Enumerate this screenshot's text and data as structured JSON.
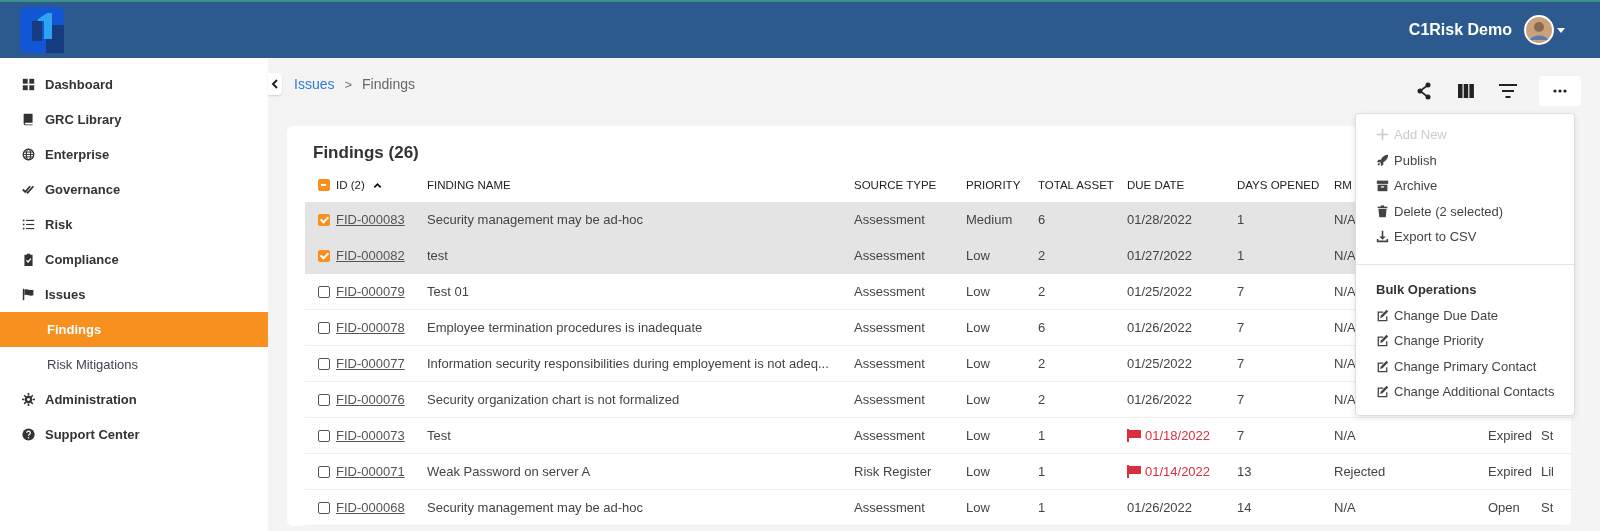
{
  "header": {
    "user_name": "C1Risk Demo"
  },
  "sidebar": {
    "items": [
      {
        "label": "Dashboard"
      },
      {
        "label": "GRC Library"
      },
      {
        "label": "Enterprise"
      },
      {
        "label": "Governance"
      },
      {
        "label": "Risk"
      },
      {
        "label": "Compliance"
      },
      {
        "label": "Issues",
        "children": [
          {
            "label": "Findings",
            "selected": true
          },
          {
            "label": "Risk Mitigations",
            "selected": false
          }
        ]
      },
      {
        "label": "Administration"
      },
      {
        "label": "Support Center"
      }
    ]
  },
  "breadcrumb": {
    "items": [
      "Issues",
      "Findings"
    ],
    "separator": ">"
  },
  "card": {
    "title": "Findings (26)"
  },
  "table": {
    "select_all_indeterminate": true,
    "sort_ascending": true,
    "columns": [
      "ID (2)",
      "FINDING NAME",
      "SOURCE TYPE",
      "PRIORITY",
      "TOTAL ASSET",
      "DUE DATE",
      "DAYS OPENED",
      "RM"
    ],
    "rows": [
      {
        "selected": true,
        "id": "FID-000083",
        "name": "Security management may be ad-hoc",
        "source_type": "Assessment",
        "priority": "Medium",
        "total_asset": "6",
        "due_date": "01/28/2022",
        "overdue": false,
        "days_opened": "1",
        "rm_status": "N/A"
      },
      {
        "selected": true,
        "id": "FID-000082",
        "name": "test",
        "source_type": "Assessment",
        "priority": "Low",
        "total_asset": "2",
        "due_date": "01/27/2022",
        "overdue": false,
        "days_opened": "1",
        "rm_status": "N/A"
      },
      {
        "selected": false,
        "id": "FID-000079",
        "name": "Test 01",
        "source_type": "Assessment",
        "priority": "Low",
        "total_asset": "2",
        "due_date": "01/25/2022",
        "overdue": false,
        "days_opened": "7",
        "rm_status": "N/A"
      },
      {
        "selected": false,
        "id": "FID-000078",
        "name": "Employee termination procedures is inadequate",
        "source_type": "Assessment",
        "priority": "Low",
        "total_asset": "6",
        "due_date": "01/26/2022",
        "overdue": false,
        "days_opened": "7",
        "rm_status": "N/A"
      },
      {
        "selected": false,
        "id": "FID-000077",
        "name": "Information security responsibilities during employement is not adeq...",
        "source_type": "Assessment",
        "priority": "Low",
        "total_asset": "2",
        "due_date": "01/25/2022",
        "overdue": false,
        "days_opened": "7",
        "rm_status": "N/A"
      },
      {
        "selected": false,
        "id": "FID-000076",
        "name": "Security organization chart is not formalized",
        "source_type": "Assessment",
        "priority": "Low",
        "total_asset": "2",
        "due_date": "01/26/2022",
        "overdue": false,
        "days_opened": "7",
        "rm_status": "N/A"
      },
      {
        "selected": false,
        "id": "FID-000073",
        "name": "Test",
        "source_type": "Assessment",
        "priority": "Low",
        "total_asset": "1",
        "due_date": "01/18/2022",
        "overdue": true,
        "days_opened": "7",
        "rm_status": "N/A",
        "status": "Expired",
        "column_10": "St"
      },
      {
        "selected": false,
        "id": "FID-000071",
        "name": "Weak Password on server A",
        "source_type": "Risk Register",
        "priority": "Low",
        "total_asset": "1",
        "due_date": "01/14/2022",
        "overdue": true,
        "days_opened": "13",
        "rm_status": "Rejected",
        "status": "Expired",
        "column_10": "Lil"
      },
      {
        "selected": false,
        "id": "FID-000068",
        "name": "Security management may be ad-hoc",
        "source_type": "Assessment",
        "priority": "Low",
        "total_asset": "1",
        "due_date": "01/26/2022",
        "overdue": false,
        "days_opened": "14",
        "rm_status": "N/A",
        "status": "Open",
        "column_10": "St"
      }
    ]
  },
  "actions_menu": {
    "items": [
      {
        "label": "Add New",
        "disabled": true
      },
      {
        "label": "Publish",
        "disabled": false
      },
      {
        "label": "Archive",
        "disabled": false
      },
      {
        "label": "Delete (2 selected)",
        "disabled": false
      },
      {
        "label": "Export to CSV",
        "disabled": false
      }
    ],
    "section_title": "Bulk Operations",
    "bulk_items": [
      "Change Due Date",
      "Change Priority",
      "Change Primary Contact",
      "Change Additional Contacts"
    ]
  }
}
